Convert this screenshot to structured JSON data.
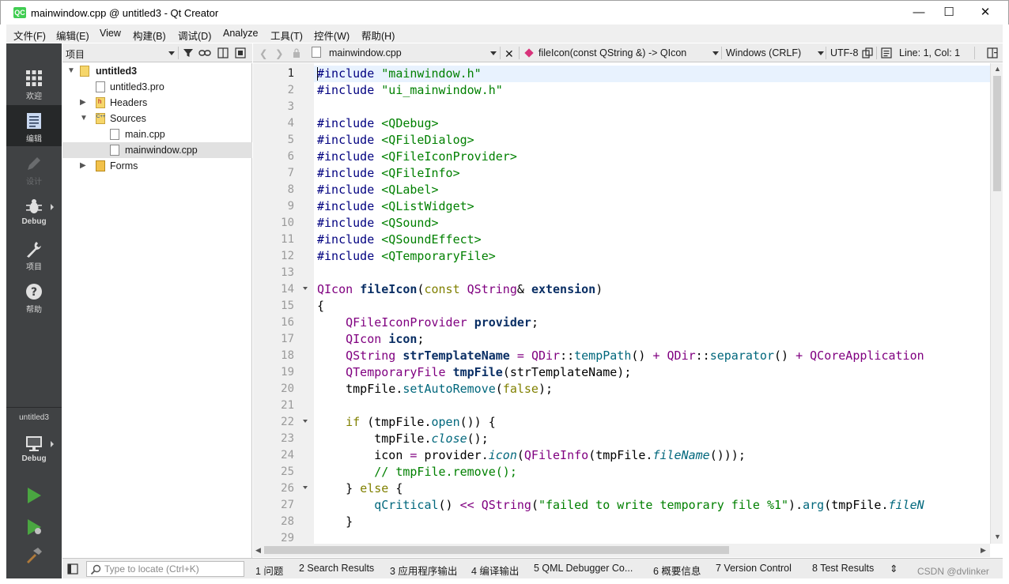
{
  "window": {
    "app_icon_text": "QC",
    "title": "mainwindow.cpp @ untitled3 - Qt Creator",
    "minimize_glyph": "—",
    "maximize_glyph": "☐",
    "close_glyph": "✕"
  },
  "menu": [
    "文件(F)",
    "编辑(E)",
    "View",
    "构建(B)",
    "调试(D)",
    "Analyze",
    "工具(T)",
    "控件(W)",
    "帮助(H)"
  ],
  "modes": {
    "welcome": "欢迎",
    "edit": "编辑",
    "design": "设计",
    "debug": "Debug",
    "projects": "项目",
    "help": "帮助",
    "kit_project": "untitled3",
    "kit_mode": "Debug",
    "help_glyph": "?"
  },
  "project_panel": {
    "title": "项目",
    "root": "untitled3",
    "items": [
      "untitled3.pro",
      "Headers",
      "Sources",
      "main.cpp",
      "mainwindow.cpp",
      "Forms"
    ],
    "header_badge": "h",
    "source_badge": "C++"
  },
  "editor_toolbar": {
    "file": "mainwindow.cpp",
    "symbol": "fileIcon(const QString &) -> QIcon",
    "line_ending": "Windows (CRLF)",
    "encoding": "UTF-8",
    "position": "Line: 1, Col: 1"
  },
  "editor": {
    "line_numbers": [
      "1",
      "2",
      "3",
      "4",
      "5",
      "6",
      "7",
      "8",
      "9",
      "10",
      "11",
      "12",
      "13",
      "14",
      "15",
      "16",
      "17",
      "18",
      "19",
      "20",
      "21",
      "22",
      "23",
      "24",
      "25",
      "26",
      "27",
      "28",
      "29"
    ],
    "code": {
      "l1a": "#include ",
      "l1b": "\"mainwindow.h\"",
      "l2a": "#include ",
      "l2b": "\"ui_mainwindow.h\"",
      "l4a": "#include ",
      "l4b": "<QDebug>",
      "l5a": "#include ",
      "l5b": "<QFileDialog>",
      "l6a": "#include ",
      "l6b": "<QFileIconProvider>",
      "l7a": "#include ",
      "l7b": "<QFileInfo>",
      "l8a": "#include ",
      "l8b": "<QLabel>",
      "l9a": "#include ",
      "l9b": "<QListWidget>",
      "l10a": "#include ",
      "l10b": "<QSound>",
      "l11a": "#include ",
      "l11b": "<QSoundEffect>",
      "l12a": "#include ",
      "l12b": "<QTemporaryFile>",
      "l14a": "QIcon",
      "l14b": " ",
      "l14c": "fileIcon",
      "l14d": "(",
      "l14e": "const",
      "l14f": " ",
      "l14g": "QString",
      "l14h": "& ",
      "l14i": "extension",
      "l14j": ")",
      "l15a": "{",
      "l16a": "    ",
      "l16b": "QFileIconProvider",
      "l16c": " ",
      "l16d": "provider",
      "l16e": ";",
      "l17a": "    ",
      "l17b": "QIcon",
      "l17c": " ",
      "l17d": "icon",
      "l17e": ";",
      "l18a": "    ",
      "l18b": "QString",
      "l18c": " ",
      "l18d": "strTemplateName",
      "l18e": " ",
      "l18f": "=",
      "l18g": " ",
      "l18h": "QDir",
      "l18i": "::",
      "l18j": "tempPath",
      "l18k": "() ",
      "l18l": "+",
      "l18m": " ",
      "l18n": "QDir",
      "l18o": "::",
      "l18p": "separator",
      "l18q": "() ",
      "l18r": "+",
      "l18s": " ",
      "l18t": "QCoreApplication",
      "l19a": "    ",
      "l19b": "QTemporaryFile",
      "l19c": " ",
      "l19d": "tmpFile",
      "l19e": "(strTemplateName);",
      "l20a": "    tmpFile.",
      "l20b": "setAutoRemove",
      "l20c": "(",
      "l20d": "false",
      "l20e": ");",
      "l22a": "    ",
      "l22b": "if",
      "l22c": " (tmpFile.",
      "l22d": "open",
      "l22e": "()) {",
      "l23a": "        tmpFile.",
      "l23b": "close",
      "l23c": "();",
      "l24a": "        icon ",
      "l24b": "=",
      "l24c": " provider.",
      "l24d": "icon",
      "l24e": "(",
      "l24f": "QFileInfo",
      "l24g": "(tmpFile.",
      "l24h": "fileName",
      "l24i": "()));",
      "l25a": "        ",
      "l25b": "// tmpFile.remove();",
      "l26a": "    } ",
      "l26b": "else",
      "l26c": " {",
      "l27a": "        ",
      "l27b": "qCritical",
      "l27c": "() ",
      "l27d": "<<",
      "l27e": " ",
      "l27f": "QString",
      "l27g": "(",
      "l27h": "\"failed to write temporary file %1\"",
      "l27i": ").",
      "l27j": "arg",
      "l27k": "(tmpFile.",
      "l27l": "fileN",
      "l28a": "    }"
    }
  },
  "status_bar": {
    "locator_placeholder": "Type to locate (Ctrl+K)",
    "tabs": [
      "1  问题",
      "2  Search Results",
      "3  应用程序输出",
      "4  编译输出",
      "5  QML Debugger Co...",
      "6  概要信息",
      "7  Version Control",
      "8  Test Results"
    ],
    "more_glyph": "⇕"
  },
  "watermark": "CSDN @dvlinker",
  "colors": {
    "sidebar": "#404244",
    "keyword": "#808000",
    "type": "#800080",
    "string": "#008000",
    "function": "#00677c",
    "current_line": "#e8f2fe"
  }
}
